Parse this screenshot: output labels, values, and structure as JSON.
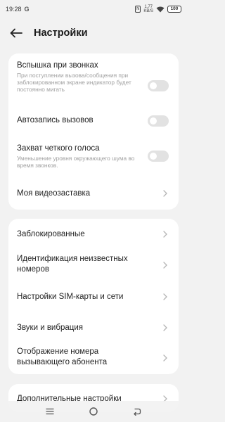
{
  "status": {
    "time": "19:28",
    "carrier_icon": "G",
    "nfc": "N",
    "net_speed": "1.77",
    "net_unit": "KB/S",
    "battery": "100"
  },
  "header": {
    "title": "Настройки"
  },
  "group1": {
    "flash": {
      "title": "Вспышка при звонках",
      "subtitle": "При поступлении вызова/сообщения при заблокированном экране индикатор будет постоянно мигать",
      "enabled": false
    },
    "autorecord": {
      "title": "Автозапись вызовов",
      "enabled": false
    },
    "clear_voice": {
      "title": "Захват четкого голоса",
      "subtitle": "Уменьшение уровня окружающего шума во время звонков.",
      "enabled": false
    },
    "video_screensaver": {
      "title": "Моя видеозаставка"
    }
  },
  "group2": {
    "blocked": {
      "title": "Заблокированные"
    },
    "unknown_id": {
      "title": "Идентификация неизвестных номеров"
    },
    "sim": {
      "title": "Настройки SIM-карты и сети"
    },
    "sounds": {
      "title": "Звуки и вибрация"
    },
    "caller_id": {
      "title": "Отображение номера вызывающего абонента"
    }
  },
  "group3": {
    "more": {
      "title": "Дополнительные настройки"
    }
  },
  "icons": {
    "back": "arrow-left-icon",
    "chevron": "chevron-right-icon",
    "nav_menu": "menu-icon",
    "nav_home": "home-icon",
    "nav_back": "back-icon"
  }
}
